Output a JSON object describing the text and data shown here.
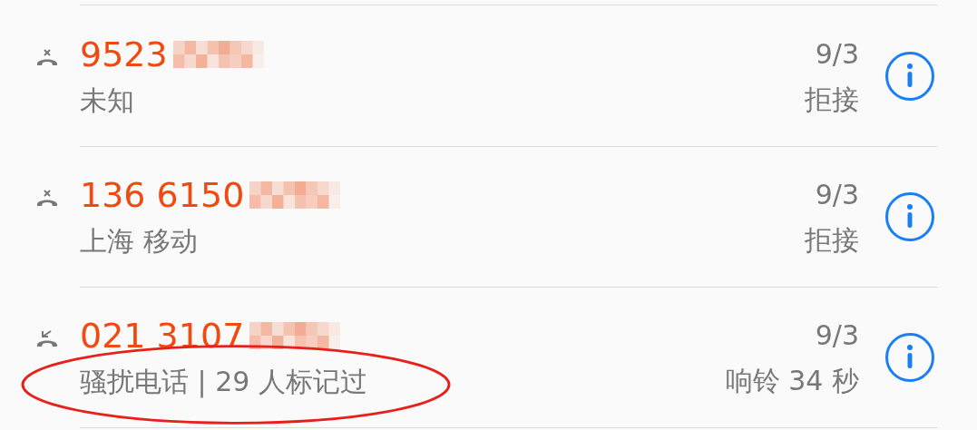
{
  "calls": [
    {
      "kind": "rejected",
      "number": "9523",
      "detail": "未知",
      "date": "9/3",
      "status": "拒接",
      "annotated": false
    },
    {
      "kind": "rejected",
      "number": "136 6150",
      "detail": "上海 移动",
      "date": "9/3",
      "status": "拒接",
      "annotated": false
    },
    {
      "kind": "missed",
      "number": "021 3107",
      "detail": "骚扰电话 | 29 人标记过",
      "date": "9/3",
      "status": "响铃 34 秒",
      "annotated": true
    }
  ]
}
